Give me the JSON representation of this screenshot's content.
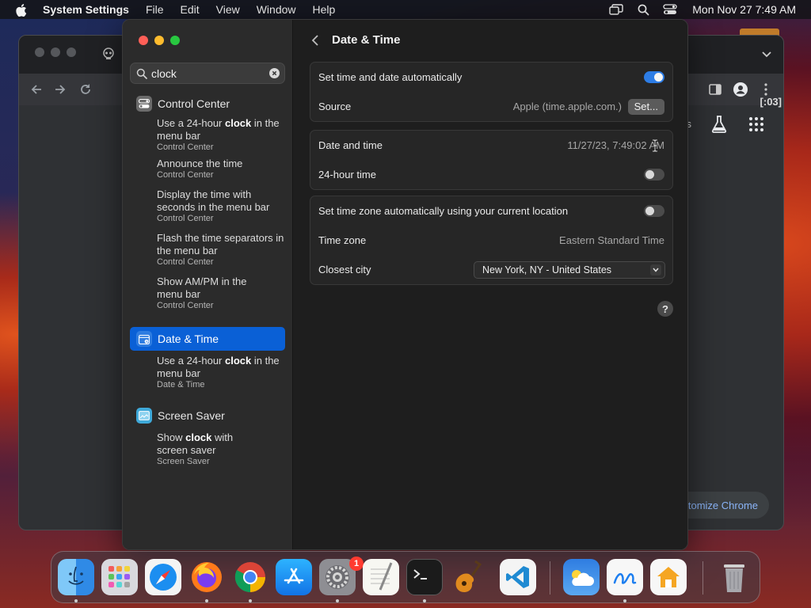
{
  "menubar": {
    "app_name": "System Settings",
    "menus": [
      "File",
      "Edit",
      "View",
      "Window",
      "Help"
    ],
    "clock": "Mon Nov 27  7:49 AM",
    "icons": [
      "screen-mirroring-icon",
      "spotlight-search-icon",
      "control-center-icon"
    ]
  },
  "background_window": {
    "partial_text": "[:03]",
    "s_partial": "s",
    "customize_label": "tomize Chrome"
  },
  "sidebar": {
    "search": {
      "value": "clock",
      "placeholder": "Search"
    },
    "groups": [
      {
        "name": "Control Center",
        "icon": "control-center-icon",
        "results": [
          {
            "before": "Use a 24-hour ",
            "match": "clock",
            "after": " in the menu bar",
            "sub": "Control Center"
          },
          {
            "before": "Announce the time",
            "match": "",
            "after": "",
            "sub": "Control Center"
          },
          {
            "before": "Display the time with seconds in the menu bar",
            "match": "",
            "after": "",
            "sub": "Control Center"
          },
          {
            "before": "Flash the time separators in the menu bar",
            "match": "",
            "after": "",
            "sub": "Control Center"
          },
          {
            "before": "Show AM/PM in the menu bar",
            "match": "",
            "after": "",
            "sub": "Control Center"
          }
        ]
      },
      {
        "name": "Date & Time",
        "icon": "date-time-icon",
        "selected": true,
        "results": [
          {
            "before": "Use a 24-hour ",
            "match": "clock",
            "after": " in the menu bar",
            "sub": "Date & Time"
          }
        ]
      },
      {
        "name": "Screen Saver",
        "icon": "screen-saver-icon",
        "results": [
          {
            "before": "Show ",
            "match": "clock",
            "after": " with screen saver",
            "sub": "Screen Saver"
          }
        ]
      }
    ]
  },
  "content": {
    "title": "Date & Time",
    "card1": {
      "auto_label": "Set time and date automatically",
      "auto_on": true,
      "source_label": "Source",
      "source_value": "Apple (time.apple.com.)",
      "set_button": "Set..."
    },
    "card2": {
      "datetime_label": "Date and time",
      "datetime_value": "11/27/23, 7:49:02 AM",
      "hour24_label": "24-hour time",
      "hour24_on": false
    },
    "card3": {
      "tz_auto_label": "Set time zone automatically using your current location",
      "tz_auto_on": false,
      "tz_label": "Time zone",
      "tz_value": "Eastern Standard Time",
      "city_label": "Closest city",
      "city_value": "New York, NY - United States"
    },
    "help": "?"
  },
  "dock": {
    "apps": [
      "Finder",
      "Launchpad",
      "Safari",
      "Firefox",
      "Google Chrome",
      "App Store",
      "System Settings",
      "TextEdit",
      "Terminal",
      "GarageBand",
      "Visual Studio Code",
      "Weather",
      "Freeform",
      "Home",
      "Trash"
    ],
    "settings_badge": "1"
  }
}
